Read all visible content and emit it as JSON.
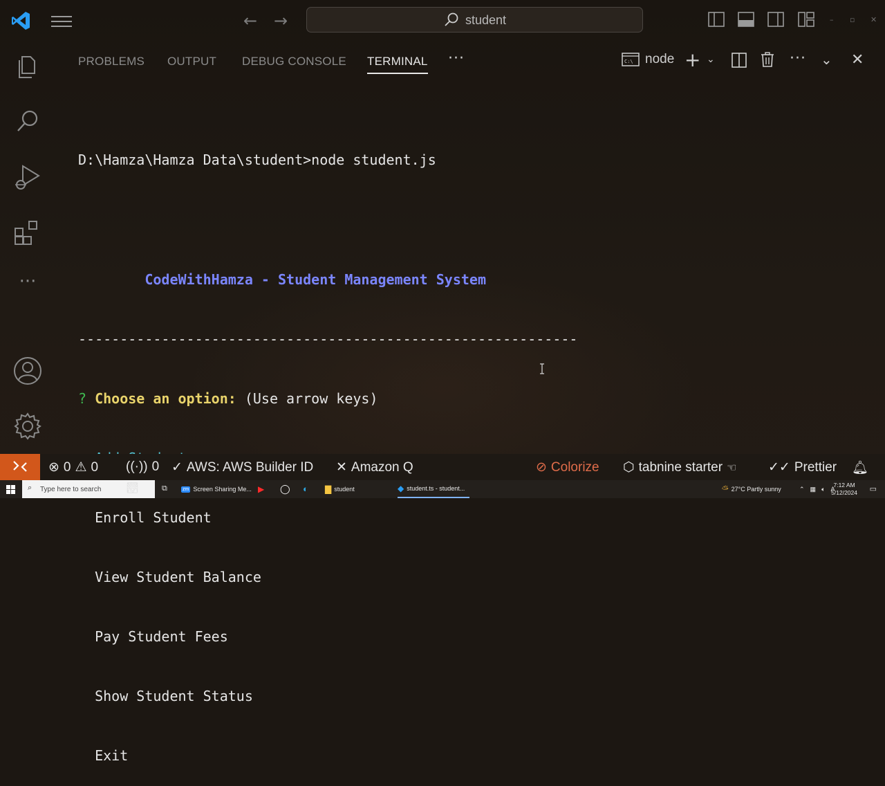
{
  "titlebar": {
    "search_text": "student"
  },
  "panel": {
    "tabs": [
      {
        "label": "PROBLEMS"
      },
      {
        "label": "OUTPUT"
      },
      {
        "label": "DEBUG CONSOLE"
      },
      {
        "label": "TERMINAL"
      }
    ],
    "active_tab": "TERMINAL",
    "terminal_name": "node"
  },
  "terminal": {
    "command_line": "D:\\Hamza\\Hamza Data\\student>node student.js",
    "banner": "CodeWithHamza - Student Management System",
    "separator": "------------------------------------------------------------",
    "question_mark": "?",
    "prompt": "Choose an option:",
    "hint": "(Use arrow keys)",
    "pointer": "❯",
    "options": [
      "Add Student",
      "Enroll Student",
      "View Student Balance",
      "Pay Student Fees",
      "Show Student Status",
      "Exit"
    ],
    "selected_option": "Add Student"
  },
  "statusbar": {
    "errors": "0",
    "warnings": "0",
    "ports": "0",
    "aws": "AWS: AWS Builder ID",
    "amazon_q": "Amazon Q",
    "colorize": "Colorize",
    "tabnine": "tabnine starter",
    "prettier": "Prettier"
  },
  "taskbar": {
    "search_placeholder": "Type here to search",
    "apps": [
      {
        "label": "Screen Sharing Me..."
      },
      {
        "label": "student"
      },
      {
        "label": "student.ts - student..."
      }
    ],
    "weather": "27°C  Partly sunny",
    "time": "7:12 AM",
    "date": "5/12/2024"
  },
  "colors": {
    "background": "#1c1712",
    "banner": "#7b86ff",
    "prompt": "#e9d36b",
    "selected": "#54c6d6",
    "remote_button": "#d2571b",
    "colorize": "#e06c4a"
  }
}
